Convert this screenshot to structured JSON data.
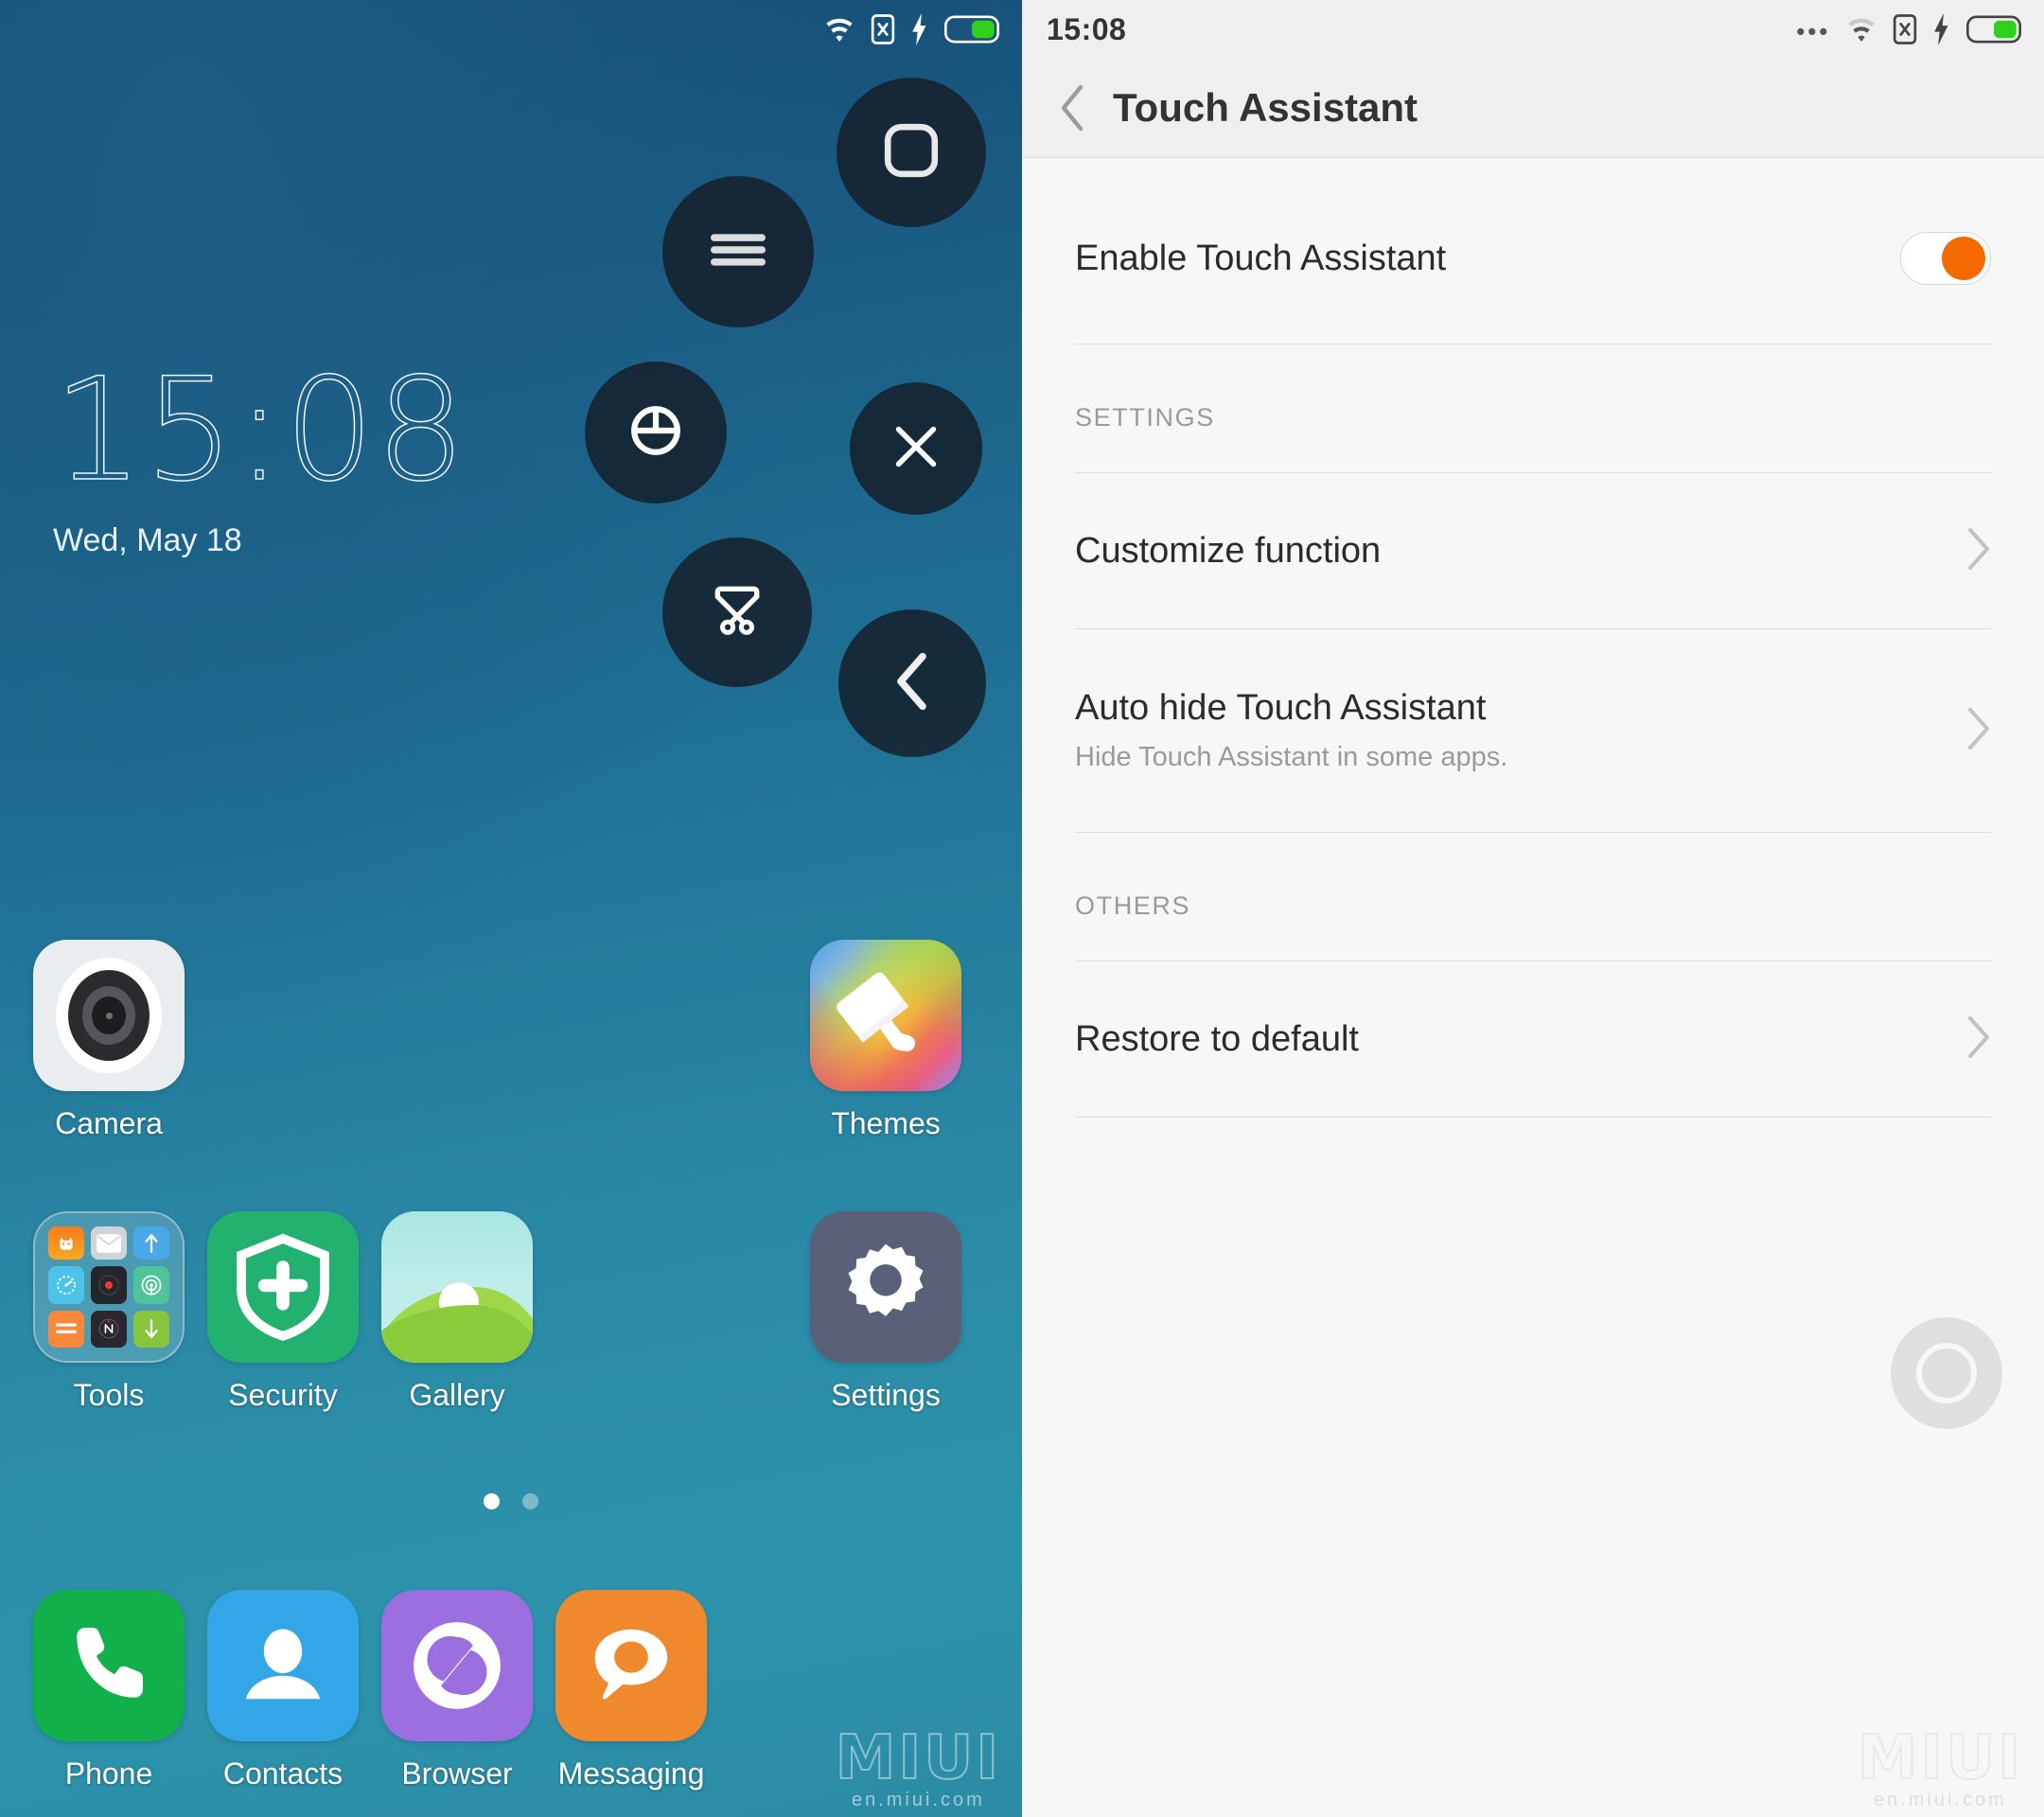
{
  "home": {
    "statusbar": {
      "icons": [
        "wifi-icon",
        "sim-x-icon",
        "charging-bolt-icon",
        "battery-icon"
      ]
    },
    "clock": {
      "time": "15:08",
      "date": "Wed, May 18"
    },
    "touch_assistant_menu": [
      {
        "name": "home-button",
        "icon": "rounded-square-icon"
      },
      {
        "name": "menu-button",
        "icon": "hamburger-icon"
      },
      {
        "name": "lock-screen-button",
        "icon": "lock-icon"
      },
      {
        "name": "close-button",
        "icon": "close-x-icon"
      },
      {
        "name": "screenshot-button",
        "icon": "scissors-icon"
      },
      {
        "name": "back-button",
        "icon": "chevron-left-icon"
      }
    ],
    "apps_row1": [
      {
        "label": "Camera",
        "icon": "camera-icon"
      },
      {
        "label": "Themes",
        "icon": "paintbrush-icon"
      }
    ],
    "apps_row2": [
      {
        "label": "Tools",
        "icon": "folder-icon"
      },
      {
        "label": "Security",
        "icon": "shield-plus-icon"
      },
      {
        "label": "Gallery",
        "icon": "landscape-icon"
      },
      {
        "label": "Settings",
        "icon": "gear-icon"
      }
    ],
    "dock": [
      {
        "label": "Phone",
        "icon": "phone-handset-icon"
      },
      {
        "label": "Contacts",
        "icon": "person-icon"
      },
      {
        "label": "Browser",
        "icon": "browser-swirl-icon"
      },
      {
        "label": "Messaging",
        "icon": "speech-bubble-icon"
      }
    ],
    "page_indicator": {
      "pages": 2,
      "active": 1
    },
    "watermark": {
      "main": "MIUI",
      "sub": "en.miui.com"
    }
  },
  "settings": {
    "statusbar": {
      "time": "15:08",
      "icons": [
        "more-dots-icon",
        "wifi-icon",
        "sim-x-icon",
        "charging-bolt-icon",
        "battery-icon"
      ]
    },
    "header": {
      "title": "Touch Assistant",
      "back_icon": "chevron-left-icon"
    },
    "enable_row": {
      "title": "Enable Touch Assistant",
      "toggle_state": "on"
    },
    "sections": [
      {
        "label": "SETTINGS",
        "rows": [
          {
            "title": "Customize function",
            "subtitle": ""
          },
          {
            "title": "Auto hide Touch Assistant",
            "subtitle": "Hide Touch Assistant in some apps."
          }
        ]
      },
      {
        "label": "OTHERS",
        "rows": [
          {
            "title": "Restore to default",
            "subtitle": ""
          }
        ]
      }
    ],
    "float_ball": {
      "name": "touch-assistant-ball"
    },
    "watermark": {
      "main": "MIUI",
      "sub": "en.miui.com"
    },
    "colors": {
      "accent": "#f46a00",
      "background": "#f7f7f7",
      "header": "#efefef"
    }
  }
}
